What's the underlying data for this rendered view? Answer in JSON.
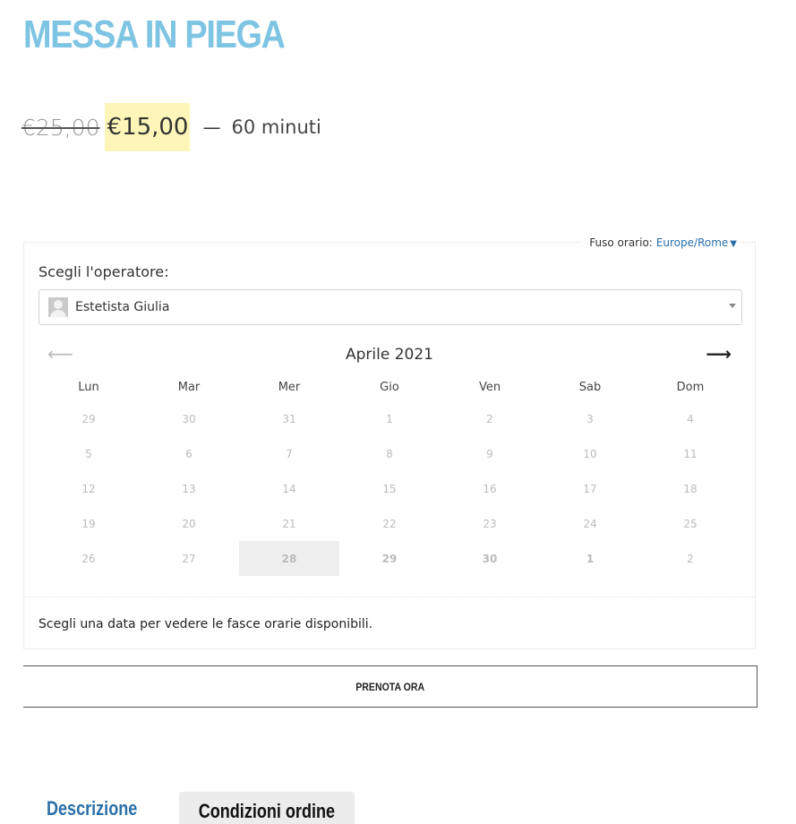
{
  "product": {
    "title": "MESSA IN PIEGA",
    "old_price": "€25,00",
    "new_price": "€15,00",
    "separator": "—",
    "duration": "60 minuti"
  },
  "booking": {
    "timezone_label": "Fuso orario:",
    "timezone_value": "Europe/Rome",
    "timezone_caret": "▼",
    "operator_label": "Scegli l'operatore:",
    "operator_value": "Estetista Giulia",
    "calendar": {
      "prev_arrow": "⟵",
      "next_arrow": "⟶",
      "month": "Aprile 2021",
      "weekdays": [
        "Lun",
        "Mar",
        "Mer",
        "Gio",
        "Ven",
        "Sab",
        "Dom"
      ],
      "weeks": [
        [
          "29",
          "30",
          "31",
          "1",
          "2",
          "3",
          "4"
        ],
        [
          "5",
          "6",
          "7",
          "8",
          "9",
          "10",
          "11"
        ],
        [
          "12",
          "13",
          "14",
          "15",
          "16",
          "17",
          "18"
        ],
        [
          "19",
          "20",
          "21",
          "22",
          "23",
          "24",
          "25"
        ],
        [
          "26",
          "27",
          "28",
          "29",
          "30",
          "1",
          "2"
        ]
      ]
    },
    "hint": "Scegli una data per vedere le fasce orarie disponibili.",
    "book_button": "PRENOTA ORA"
  },
  "tabs": {
    "description": "Descrizione",
    "conditions": "Condizioni ordine"
  },
  "colors": {
    "title": "#7ec4e3",
    "price_highlight": "#fdf6b8",
    "link": "#2a6fa8",
    "selected_day_bg": "#efefef"
  }
}
